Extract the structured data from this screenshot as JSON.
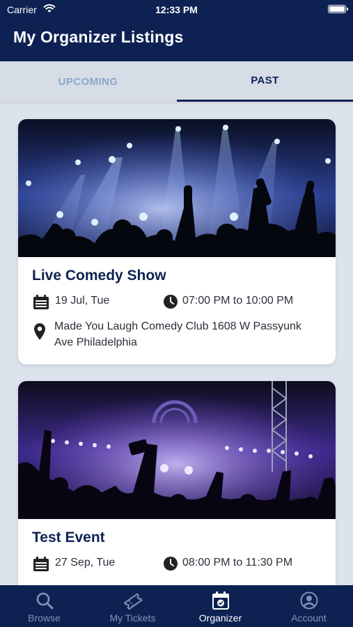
{
  "status_bar": {
    "carrier": "Carrier",
    "time": "12:33 PM"
  },
  "header": {
    "title": "My Organizer Listings"
  },
  "tabs": [
    {
      "label": "UPCOMING",
      "active": false
    },
    {
      "label": "PAST",
      "active": true
    }
  ],
  "events": [
    {
      "title": "Live Comedy Show",
      "date": "19 Jul, Tue",
      "time": "07:00 PM to 10:00 PM",
      "venue": "Made You Laugh Comedy Club 1608 W Passyunk Ave Philadelphia"
    },
    {
      "title": "Test Event",
      "date": "27 Sep, Tue",
      "time": "08:00 PM to 11:30 PM"
    }
  ],
  "bottom_nav": [
    {
      "label": "Browse",
      "icon": "search-icon",
      "active": false
    },
    {
      "label": "My Tickets",
      "icon": "ticket-icon",
      "active": false
    },
    {
      "label": "Organizer",
      "icon": "calendar-icon",
      "active": true
    },
    {
      "label": "Account",
      "icon": "account-icon",
      "active": false
    }
  ],
  "colors": {
    "primary": "#0d2252",
    "inactive_tab": "#8aa6c8",
    "background": "#dde3ec"
  }
}
